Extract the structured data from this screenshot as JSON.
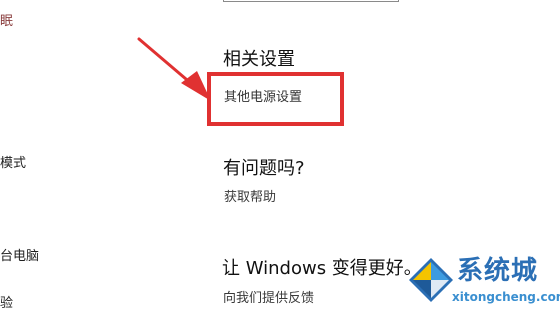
{
  "sidebar": {
    "items": [
      {
        "label": "眠"
      },
      {
        "label": "模式"
      },
      {
        "label": "台电脑"
      },
      {
        "label": "验"
      }
    ]
  },
  "related_settings": {
    "title": "相关设置",
    "power_link": "其他电源设置"
  },
  "question": {
    "title": "有问题吗?",
    "help_link": "获取帮助"
  },
  "windows_better": {
    "title": "让 Windows 变得更好。",
    "feedback_link": "向我们提供反馈"
  },
  "watermark": {
    "brand": "系统城",
    "domain": "xitongcheng.com"
  },
  "colors": {
    "highlight": "#e03131",
    "watermark_blue": "#2b6fb5"
  }
}
